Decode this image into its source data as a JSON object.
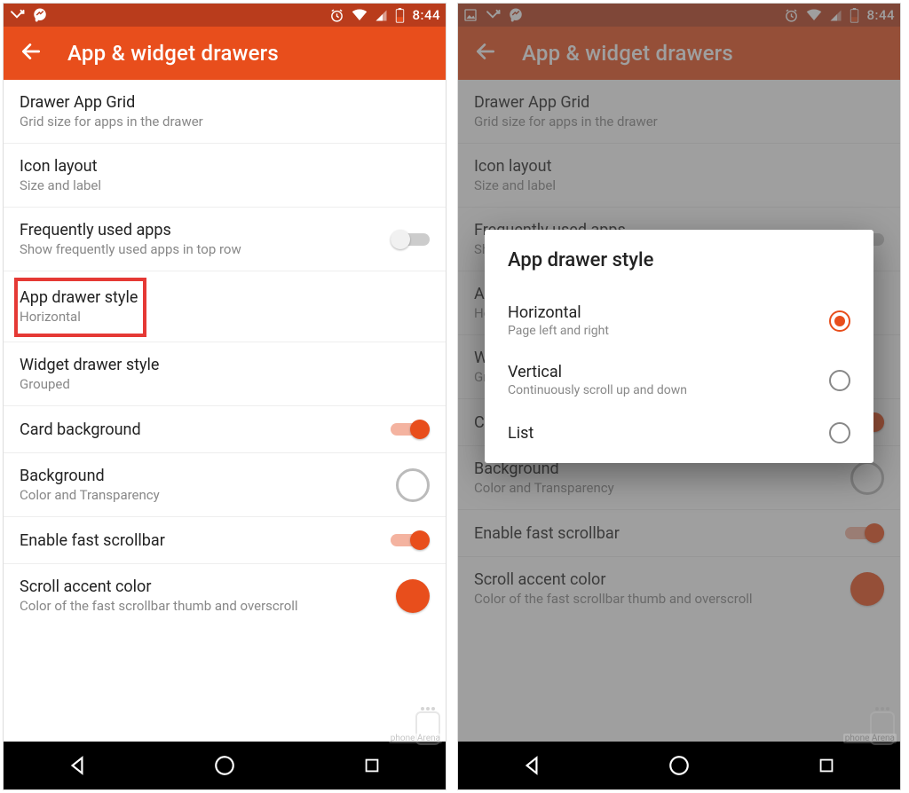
{
  "status": {
    "time": "8:44",
    "icons_left": [
      "missed-call",
      "messenger"
    ],
    "icons_left_alt": [
      "image",
      "missed-call",
      "messenger"
    ],
    "icons_right": [
      "alarm",
      "wifi",
      "cell-signal",
      "battery"
    ]
  },
  "appbar": {
    "title": "App & widget drawers"
  },
  "settings": [
    {
      "key": "drawer_grid",
      "title": "Drawer App Grid",
      "sub": "Grid size for apps in the drawer",
      "control": "none"
    },
    {
      "key": "icon_layout",
      "title": "Icon layout",
      "sub": "Size and label",
      "control": "none"
    },
    {
      "key": "frequently_used",
      "title": "Frequently used apps",
      "sub": "Show frequently used apps in top row",
      "control": "switch",
      "value": false
    },
    {
      "key": "app_drawer_style",
      "title": "App drawer style",
      "sub": "Horizontal",
      "control": "none",
      "highlight": true
    },
    {
      "key": "widget_drawer_style",
      "title": "Widget drawer style",
      "sub": "Grouped",
      "control": "none"
    },
    {
      "key": "card_bg",
      "title": "Card background",
      "sub": "",
      "control": "switch",
      "value": true
    },
    {
      "key": "background",
      "title": "Background",
      "sub": "Color and Transparency",
      "control": "swatch",
      "value": "empty"
    },
    {
      "key": "fast_scrollbar",
      "title": "Enable fast scrollbar",
      "sub": "",
      "control": "switch",
      "value": true
    },
    {
      "key": "scroll_accent",
      "title": "Scroll accent color",
      "sub": "Color of the fast scrollbar thumb and overscroll",
      "control": "swatch",
      "value": "filled"
    }
  ],
  "dialog": {
    "title": "App drawer style",
    "options": [
      {
        "title": "Horizontal",
        "sub": "Page left and right",
        "selected": true
      },
      {
        "title": "Vertical",
        "sub": "Continuously scroll up and down",
        "selected": false
      },
      {
        "title": "List",
        "sub": "",
        "selected": false
      }
    ]
  },
  "watermark": "phone Arena",
  "colors": {
    "accent": "#e84e1c",
    "accent_dark": "#b93c1c",
    "highlight": "#e53935"
  }
}
